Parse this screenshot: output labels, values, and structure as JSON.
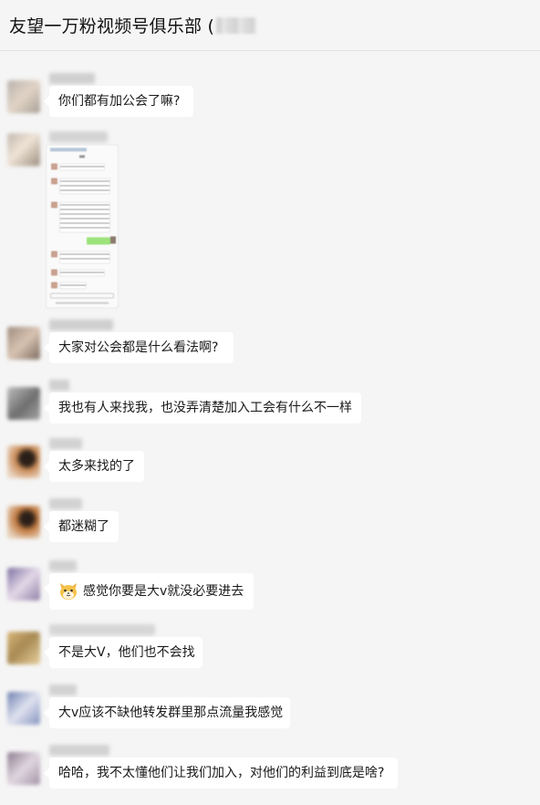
{
  "header": {
    "title": "友望一万粉视频号俱乐部 ("
  },
  "messages": [
    {
      "text": "你们都有加公会了嘛?"
    },
    {
      "text": "大家对公会都是什么看法啊?"
    },
    {
      "text": "我也有人来找我，也没弄清楚加入工会有什么不一样"
    },
    {
      "text": "太多来找的了"
    },
    {
      "text": "都迷糊了"
    },
    {
      "text": "感觉你要是大v就没必要进去",
      "emoji": "cat-face-emoji-icon"
    },
    {
      "text": "不是大V，他们也不会找"
    },
    {
      "text": "大v应该不缺他转发群里那点流量我感觉"
    },
    {
      "text": "哈哈，我不太懂他们让我们加入，对他们的利益到底是啥?"
    }
  ],
  "colors": {
    "background": "#f5f5f5",
    "bubble": "#ffffff",
    "text": "#1a1a1a",
    "divider": "#e2e2e2"
  }
}
